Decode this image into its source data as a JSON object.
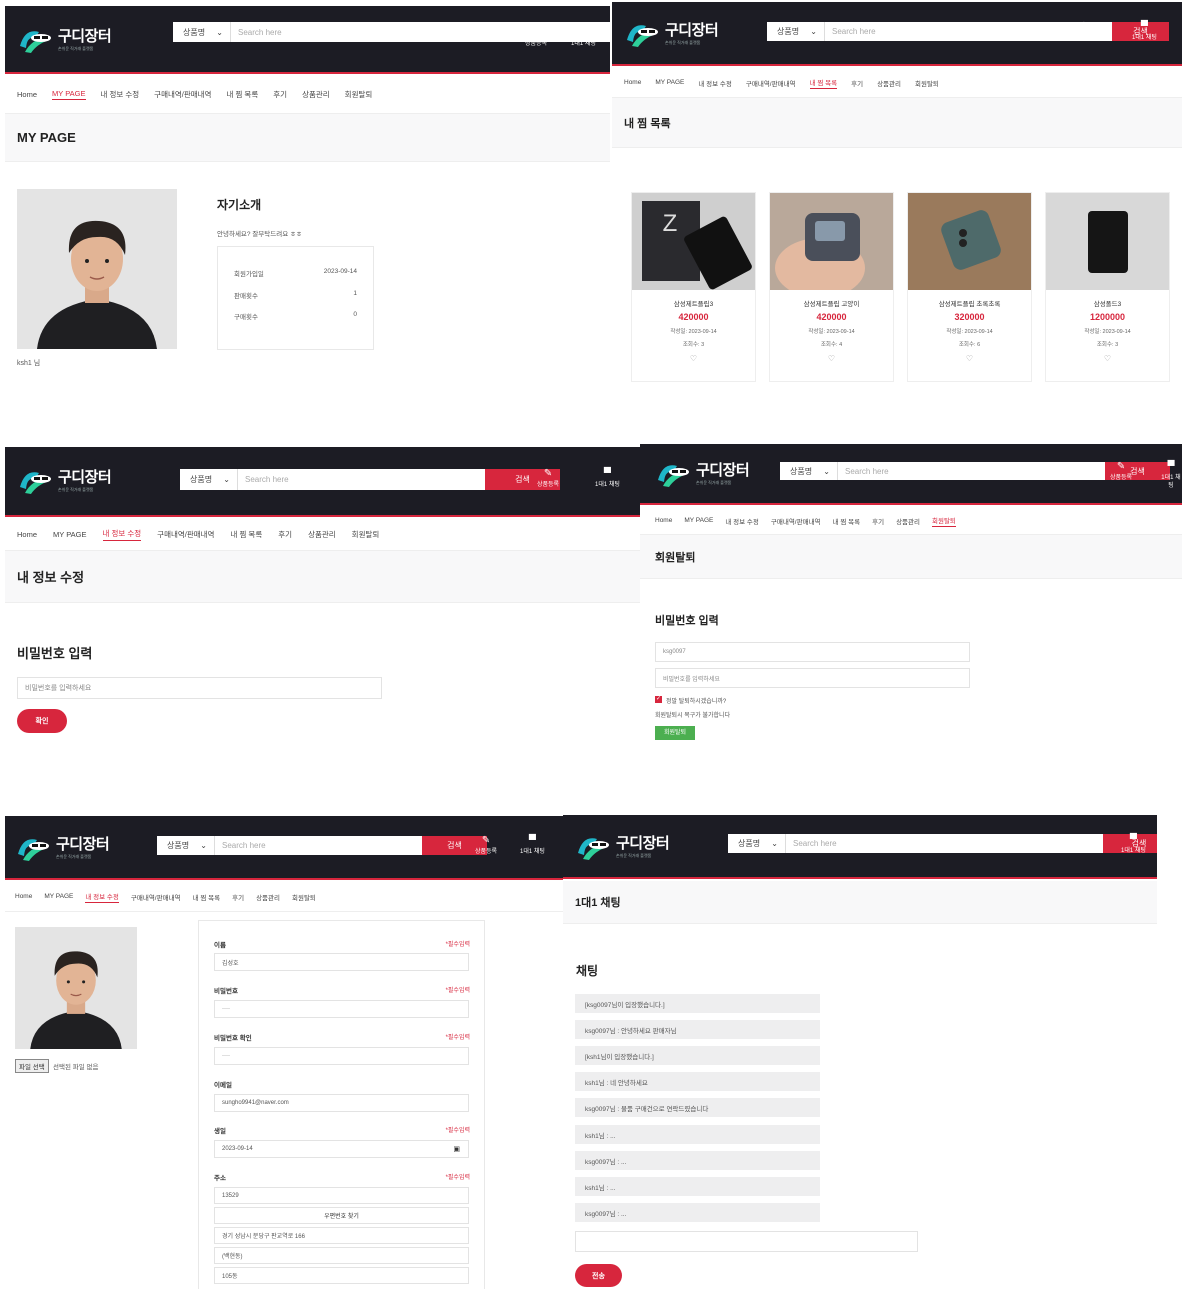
{
  "header": {
    "logo_title": "구디장터",
    "logo_sub": "손쉬운 직거래 플랫폼",
    "search_category": "상품명",
    "search_placeholder": "Search here",
    "search_button": "검색",
    "register_label": "상품등록",
    "chat_label": "1대1 채팅"
  },
  "nav": [
    "Home",
    "MY PAGE",
    "내 정보 수정",
    "구매내역/판매내역",
    "내 찜 목록",
    "후기",
    "상품관리",
    "회원탈퇴"
  ],
  "mypage": {
    "title": "MY PAGE",
    "intro_heading": "자기소개",
    "intro_text": "안녕하세요? 잘부탁드려요 ㅎㅎ",
    "stats": [
      {
        "label": "회원가입일",
        "value": "2023-09-14"
      },
      {
        "label": "판매횟수",
        "value": "1"
      },
      {
        "label": "구매횟수",
        "value": "0"
      }
    ],
    "username": "ksh1 님"
  },
  "wishlist": {
    "title": "내 찜 목록",
    "items": [
      {
        "name": "삼성제트플립3",
        "price": "420000",
        "date": "작성일: 2023-09-14",
        "views": "조회수: 3"
      },
      {
        "name": "삼성제트플립 고양이",
        "price": "420000",
        "date": "작성일: 2023-09-14",
        "views": "조회수: 4"
      },
      {
        "name": "삼성제트플립 초록초록",
        "price": "320000",
        "date": "작성일: 2023-09-14",
        "views": "조회수: 6"
      },
      {
        "name": "삼성폴드3",
        "price": "1200000",
        "date": "작성일: 2023-09-14",
        "views": "조회수: 3"
      }
    ]
  },
  "edit_pw": {
    "title": "내 정보 수정",
    "heading": "비밀번호 입력",
    "placeholder": "비밀번호를 입력하세요",
    "button": "확인"
  },
  "withdraw": {
    "title": "회원탈퇴",
    "heading": "비밀번호 입력",
    "id_value": "ksg0097",
    "pw_placeholder": "비밀번호를 입력하세요",
    "confirm_text": "정말 탈퇴하시겠습니까?",
    "warning": "회원탈퇴시 복구가 불가합니다",
    "button": "회원탈퇴"
  },
  "edit_form": {
    "file_button": "파일 선택",
    "file_status": "선택된 파일 없음",
    "required": "*필수입력",
    "name_label": "이름",
    "name_value": "김성호",
    "pw_label": "비밀번호",
    "pw_value": "····",
    "pw_confirm_label": "비밀번호 확인",
    "pw_confirm_value": "····",
    "email_label": "이메일",
    "email_value": "sungho9941@naver.com",
    "birth_label": "생일",
    "birth_value": "2023-09-14",
    "addr_label": "주소",
    "zip_value": "13529",
    "zip_button": "우편번호 찾기",
    "addr_value": "경기 성남시 분당구 판교역로 166",
    "addr_extra": "(백현동)",
    "addr_detail": "105동"
  },
  "chat": {
    "title": "1대1 채팅",
    "heading": "채팅",
    "messages": [
      "[ksg0097님이 입장했습니다.]",
      "ksg0097님 : 안녕하세요 판매자님",
      "[ksh1님이 입장했습니다.]",
      "ksh1님 : 네 안녕하세요",
      "ksg0097님 : 물품 구매건으로 연락드렸습니다",
      "ksh1님 : ...",
      "ksg0097님 : ...",
      "ksh1님 : ...",
      "ksg0097님 : ..."
    ],
    "send_button": "전송"
  },
  "colors": {
    "accent": "#d7263d",
    "header_bg": "#1c1c24",
    "green": "#4caf50"
  }
}
